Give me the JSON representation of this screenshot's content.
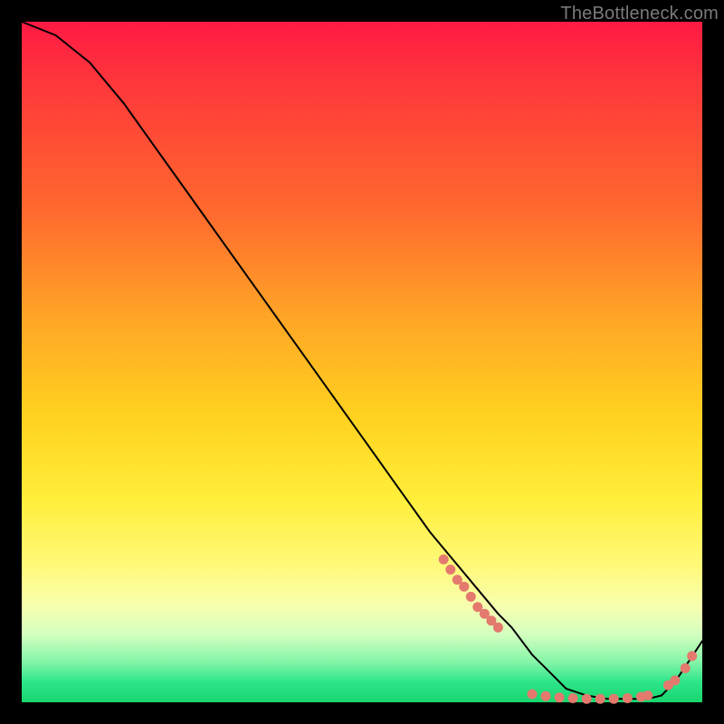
{
  "watermark": "TheBottleneck.com",
  "colors": {
    "line": "#000000",
    "dot": "#e4796e",
    "bg_black": "#000000"
  },
  "chart_data": {
    "type": "line",
    "title": "",
    "xlabel": "",
    "ylabel": "",
    "xlim": [
      0,
      100
    ],
    "ylim": [
      0,
      100
    ],
    "grid": false,
    "series": [
      {
        "name": "curve",
        "x": [
          0,
          5,
          10,
          15,
          20,
          25,
          30,
          35,
          40,
          45,
          50,
          55,
          60,
          65,
          70,
          72,
          75,
          78,
          80,
          83,
          86,
          88,
          90,
          92,
          94,
          96,
          98,
          100
        ],
        "y": [
          100,
          98,
          94,
          88,
          81,
          74,
          67,
          60,
          53,
          46,
          39,
          32,
          25,
          19,
          13,
          11,
          7,
          4,
          2,
          1,
          0.5,
          0.5,
          0.5,
          0.5,
          1,
          3,
          6,
          9
        ]
      }
    ],
    "dot_clusters": [
      {
        "comment": "descending segment ~x 62-70",
        "points": [
          {
            "x": 62,
            "y": 21
          },
          {
            "x": 63,
            "y": 19.5
          },
          {
            "x": 64,
            "y": 18
          },
          {
            "x": 65,
            "y": 17
          },
          {
            "x": 66,
            "y": 15.5
          },
          {
            "x": 67,
            "y": 14
          },
          {
            "x": 68,
            "y": 13
          },
          {
            "x": 69,
            "y": 12
          },
          {
            "x": 70,
            "y": 11
          }
        ]
      },
      {
        "comment": "near-bottom flat ~x 75-92",
        "points": [
          {
            "x": 75,
            "y": 1.2
          },
          {
            "x": 77,
            "y": 0.9
          },
          {
            "x": 79,
            "y": 0.7
          },
          {
            "x": 81,
            "y": 0.6
          },
          {
            "x": 83,
            "y": 0.5
          },
          {
            "x": 85,
            "y": 0.5
          },
          {
            "x": 87,
            "y": 0.5
          },
          {
            "x": 89,
            "y": 0.6
          },
          {
            "x": 91,
            "y": 0.8
          },
          {
            "x": 92,
            "y": 1.0
          }
        ]
      },
      {
        "comment": "rising tail ~x 95-99",
        "points": [
          {
            "x": 95,
            "y": 2.5
          },
          {
            "x": 96,
            "y": 3.2
          },
          {
            "x": 97.5,
            "y": 5.0
          },
          {
            "x": 98.5,
            "y": 6.8
          }
        ]
      }
    ]
  }
}
